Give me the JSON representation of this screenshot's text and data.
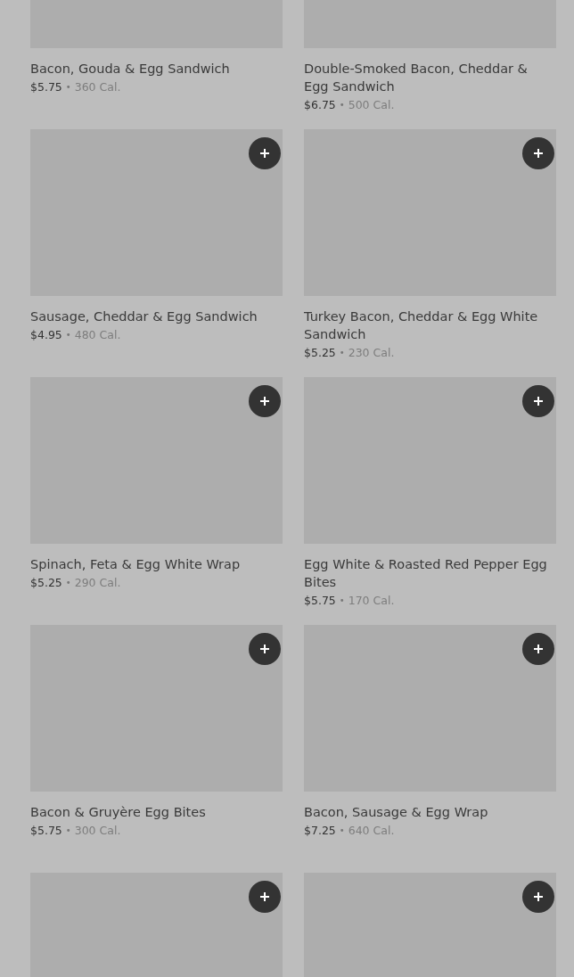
{
  "items": [
    {
      "name": "Bacon, Gouda & Egg Sandwich",
      "price": "$5.75",
      "separator": "•",
      "calories": "360 Cal."
    },
    {
      "name": "Double-Smoked Bacon, Cheddar & Egg Sandwich",
      "price": "$6.75",
      "separator": "•",
      "calories": "500 Cal."
    },
    {
      "name": "Sausage, Cheddar & Egg Sandwich",
      "price": "$4.95",
      "separator": "•",
      "calories": "480 Cal."
    },
    {
      "name": "Turkey Bacon, Cheddar & Egg White Sandwich",
      "price": "$5.25",
      "separator": "•",
      "calories": "230 Cal."
    },
    {
      "name": "Spinach, Feta & Egg White Wrap",
      "price": "$5.25",
      "separator": "•",
      "calories": "290 Cal."
    },
    {
      "name": "Egg White & Roasted Red Pepper Egg Bites",
      "price": "$5.75",
      "separator": "•",
      "calories": "170 Cal."
    },
    {
      "name": "Bacon & Gruyère Egg Bites",
      "price": "$5.75",
      "separator": "•",
      "calories": "300 Cal."
    },
    {
      "name": "Bacon, Sausage & Egg Wrap",
      "price": "$7.25",
      "separator": "•",
      "calories": "640 Cal."
    },
    {
      "kind": "picture"
    },
    {
      "kind": "picture"
    }
  ]
}
